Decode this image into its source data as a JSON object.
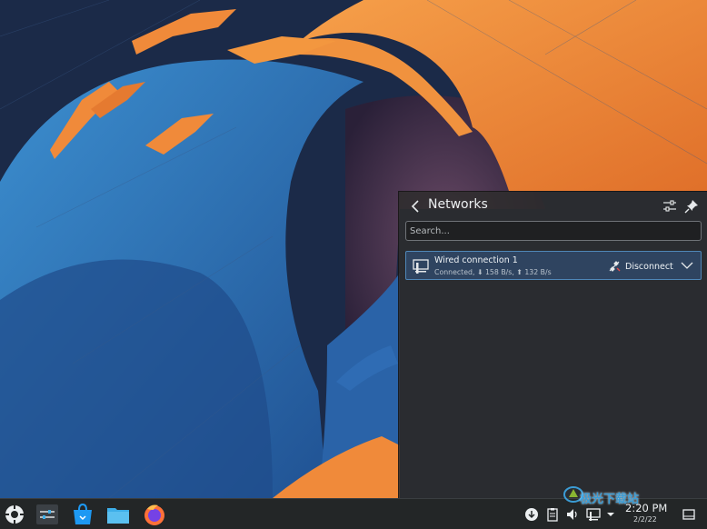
{
  "popup": {
    "title": "Networks",
    "search_placeholder": "Search...",
    "connection": {
      "name": "Wired connection 1",
      "status": "Connected, ⬇ 158 B/s, ⬆ 132 B/s",
      "action_label": "Disconnect"
    }
  },
  "taskbar": {
    "apps": [
      "launcher-icon",
      "system-settings-icon",
      "discover-icon",
      "dolphin-files-icon",
      "firefox-icon"
    ],
    "tray_icons": [
      "update-icon",
      "clipboard-icon",
      "volume-icon",
      "network-icon",
      "tray-expand-icon"
    ],
    "clock_time": "2:20 PM",
    "clock_date": "2/2/22"
  },
  "watermark": {
    "text": "极光下载站"
  },
  "colors": {
    "accent": "#3daee9",
    "popup_bg": "#2d2c2c",
    "wallpaper_orange": "#f08a3a",
    "wallpaper_blue": "#2a5fa6"
  }
}
